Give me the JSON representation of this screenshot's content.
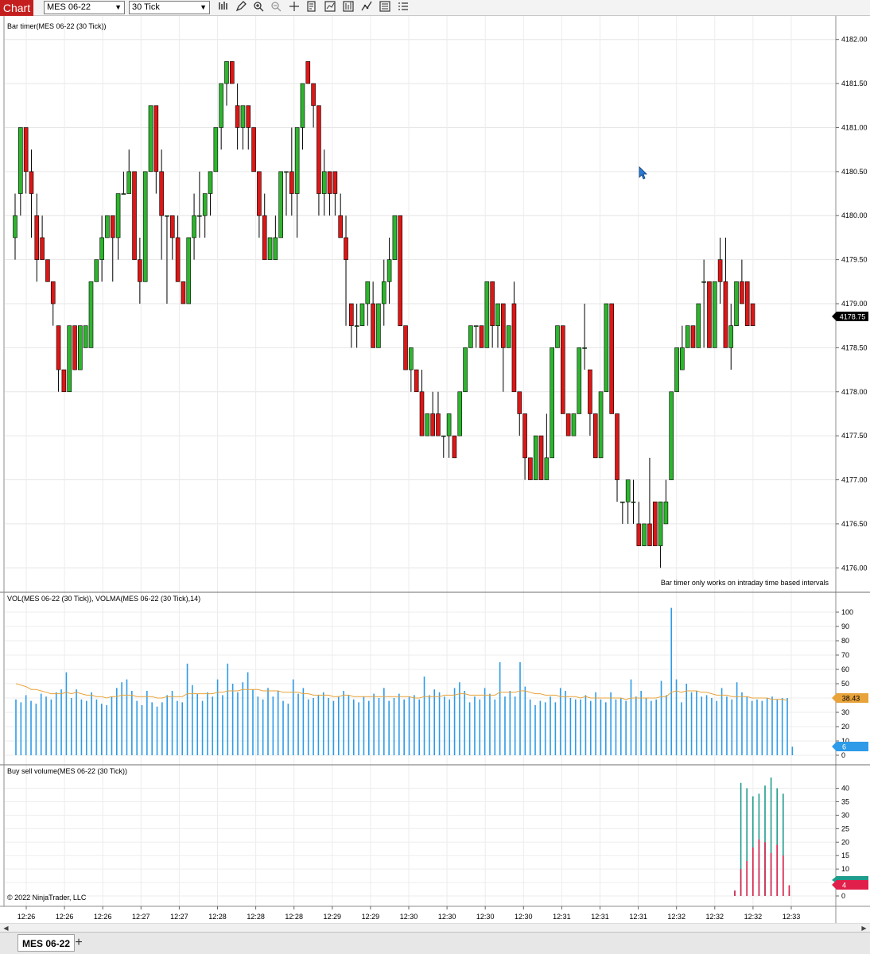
{
  "toolbar": {
    "title": "Chart",
    "instrument": "MES 06-22",
    "interval": "30 Tick",
    "icons": [
      "bar-type-icon",
      "draw-pencil-icon",
      "zoom-in-icon",
      "zoom-out-icon",
      "crosshair-icon",
      "data-box-icon",
      "indicators-icon",
      "strategies-icon",
      "drawing-tools-icon",
      "properties-icon",
      "chart-trader-icon"
    ]
  },
  "price_panel": {
    "label": "Bar timer(MES 06-22 (30 Tick))",
    "message": "Bar timer only works on intraday time based intervals",
    "price_ticks": [
      "4182.00",
      "4181.50",
      "4181.00",
      "4180.50",
      "4180.00",
      "4179.50",
      "4179.00",
      "4178.50",
      "4178.00",
      "4177.50",
      "4177.00",
      "4176.50",
      "4176.00"
    ],
    "last_price": "4178.75",
    "colors": {
      "up": "#2db52d",
      "down": "#dd1616",
      "last_badge": "#000000"
    }
  },
  "volume_panel": {
    "label": "VOL(MES 06-22 (30 Tick)), VOLMA(MES 06-22 (30 Tick),14)",
    "ticks": [
      "100",
      "90",
      "80",
      "70",
      "60",
      "50",
      "40",
      "30",
      "20",
      "10",
      "0"
    ],
    "volma_value": "38.43",
    "last_volume": "6",
    "colors": {
      "volume": "#2d9be8",
      "volma": "#e8a33a"
    }
  },
  "buysell_panel": {
    "label": "Buy sell volume(MES 06-22 (30 Tick))",
    "ticks": [
      "40",
      "35",
      "30",
      "25",
      "20",
      "15",
      "10",
      "5",
      "0"
    ],
    "buy_value": "",
    "sell_value": "4",
    "colors": {
      "buy": "#1f9c8c",
      "sell": "#e0204a"
    }
  },
  "copyright": "© 2022 NinjaTrader, LLC",
  "time_ticks": [
    "12:26",
    "12:26",
    "12:26",
    "12:27",
    "12:27",
    "12:28",
    "12:28",
    "12:28",
    "12:29",
    "12:29",
    "12:30",
    "12:30",
    "12:30",
    "12:30",
    "12:31",
    "12:31",
    "12:31",
    "12:32",
    "12:32",
    "12:32",
    "12:33"
  ],
  "tab": {
    "label": "MES 06-22",
    "add": "+"
  },
  "chart_data": {
    "type": "candlestick",
    "bars": [
      {
        "o": 4179.75,
        "h": 4180.25,
        "l": 4179.5,
        "c": 4180.0
      },
      {
        "o": 4180.25,
        "h": 4181.0,
        "l": 4180.0,
        "c": 4181.0
      },
      {
        "o": 4181.0,
        "h": 4181.0,
        "l": 4180.25,
        "c": 4180.5
      },
      {
        "o": 4180.5,
        "h": 4180.75,
        "l": 4179.75,
        "c": 4180.25
      },
      {
        "o": 4180.0,
        "h": 4180.25,
        "l": 4179.25,
        "c": 4179.5
      },
      {
        "o": 4179.75,
        "h": 4180.0,
        "l": 4179.5,
        "c": 4179.5
      },
      {
        "o": 4179.5,
        "h": 4179.5,
        "l": 4179.25,
        "c": 4179.25
      },
      {
        "o": 4179.25,
        "h": 4179.25,
        "l": 4178.75,
        "c": 4179.0
      },
      {
        "o": 4178.75,
        "h": 4178.75,
        "l": 4178.0,
        "c": 4178.25
      },
      {
        "o": 4178.25,
        "h": 4178.25,
        "l": 4178.0,
        "c": 4178.0
      },
      {
        "o": 4178.0,
        "h": 4178.75,
        "l": 4178.0,
        "c": 4178.75
      },
      {
        "o": 4178.75,
        "h": 4178.75,
        "l": 4178.25,
        "c": 4178.25
      },
      {
        "o": 4178.25,
        "h": 4178.75,
        "l": 4178.25,
        "c": 4178.75
      },
      {
        "o": 4178.5,
        "h": 4178.75,
        "l": 4178.5,
        "c": 4178.75
      },
      {
        "o": 4178.5,
        "h": 4179.25,
        "l": 4178.5,
        "c": 4179.25
      },
      {
        "o": 4179.25,
        "h": 4179.5,
        "l": 4179.25,
        "c": 4179.5
      },
      {
        "o": 4179.5,
        "h": 4180.0,
        "l": 4179.25,
        "c": 4179.75
      },
      {
        "o": 4179.75,
        "h": 4180.0,
        "l": 4179.75,
        "c": 4180.0
      },
      {
        "o": 4180.0,
        "h": 4180.0,
        "l": 4179.25,
        "c": 4179.75
      },
      {
        "o": 4179.75,
        "h": 4180.25,
        "l": 4179.5,
        "c": 4180.25
      },
      {
        "o": 4180.25,
        "h": 4180.5,
        "l": 4180.25,
        "c": 4180.25
      },
      {
        "o": 4180.25,
        "h": 4180.75,
        "l": 4180.25,
        "c": 4180.5
      },
      {
        "o": 4180.5,
        "h": 4180.5,
        "l": 4179.5,
        "c": 4179.5
      },
      {
        "o": 4179.5,
        "h": 4179.75,
        "l": 4179.0,
        "c": 4179.25
      },
      {
        "o": 4179.25,
        "h": 4180.5,
        "l": 4179.25,
        "c": 4180.5
      },
      {
        "o": 4180.5,
        "h": 4181.25,
        "l": 4180.5,
        "c": 4181.25
      },
      {
        "o": 4181.25,
        "h": 4181.25,
        "l": 4180.25,
        "c": 4180.5
      },
      {
        "o": 4180.5,
        "h": 4180.75,
        "l": 4179.5,
        "c": 4180.0
      },
      {
        "o": 4180.0,
        "h": 4180.0,
        "l": 4179.0,
        "c": 4180.0
      },
      {
        "o": 4180.0,
        "h": 4180.0,
        "l": 4179.5,
        "c": 4179.75
      },
      {
        "o": 4179.75,
        "h": 4180.0,
        "l": 4179.25,
        "c": 4179.25
      },
      {
        "o": 4179.25,
        "h": 4179.25,
        "l": 4179.0,
        "c": 4179.0
      },
      {
        "o": 4179.0,
        "h": 4179.75,
        "l": 4179.0,
        "c": 4179.75
      },
      {
        "o": 4179.75,
        "h": 4180.25,
        "l": 4179.5,
        "c": 4180.0
      },
      {
        "o": 4180.0,
        "h": 4180.5,
        "l": 4179.75,
        "c": 4180.0
      },
      {
        "o": 4180.0,
        "h": 4180.25,
        "l": 4179.75,
        "c": 4180.25
      },
      {
        "o": 4180.25,
        "h": 4180.5,
        "l": 4180.0,
        "c": 4180.5
      },
      {
        "o": 4180.5,
        "h": 4181.0,
        "l": 4180.5,
        "c": 4181.0
      },
      {
        "o": 4181.0,
        "h": 4181.5,
        "l": 4180.75,
        "c": 4181.5
      },
      {
        "o": 4181.5,
        "h": 4181.75,
        "l": 4181.25,
        "c": 4181.75
      },
      {
        "o": 4181.75,
        "h": 4181.75,
        "l": 4181.5,
        "c": 4181.5
      },
      {
        "o": 4181.25,
        "h": 4181.5,
        "l": 4180.75,
        "c": 4181.0
      },
      {
        "o": 4181.0,
        "h": 4181.25,
        "l": 4180.75,
        "c": 4181.25
      },
      {
        "o": 4181.25,
        "h": 4181.25,
        "l": 4180.75,
        "c": 4181.0
      },
      {
        "o": 4181.0,
        "h": 4181.0,
        "l": 4180.5,
        "c": 4180.5
      },
      {
        "o": 4180.5,
        "h": 4180.5,
        "l": 4179.75,
        "c": 4180.0
      },
      {
        "o": 4180.0,
        "h": 4180.25,
        "l": 4179.5,
        "c": 4179.5
      },
      {
        "o": 4179.5,
        "h": 4179.75,
        "l": 4179.5,
        "c": 4179.75
      },
      {
        "o": 4179.5,
        "h": 4180.0,
        "l": 4179.5,
        "c": 4179.75
      },
      {
        "o": 4179.75,
        "h": 4180.5,
        "l": 4179.75,
        "c": 4180.5
      },
      {
        "o": 4180.5,
        "h": 4180.5,
        "l": 4180.0,
        "c": 4180.5
      },
      {
        "o": 4180.5,
        "h": 4181.0,
        "l": 4180.0,
        "c": 4180.25
      },
      {
        "o": 4180.25,
        "h": 4181.0,
        "l": 4179.75,
        "c": 4181.0
      },
      {
        "o": 4181.0,
        "h": 4181.5,
        "l": 4180.75,
        "c": 4181.5
      },
      {
        "o": 4181.75,
        "h": 4181.75,
        "l": 4181.5,
        "c": 4181.5
      },
      {
        "o": 4181.5,
        "h": 4181.5,
        "l": 4181.0,
        "c": 4181.25
      },
      {
        "o": 4181.25,
        "h": 4181.25,
        "l": 4180.0,
        "c": 4180.25
      },
      {
        "o": 4180.25,
        "h": 4180.75,
        "l": 4180.0,
        "c": 4180.5
      },
      {
        "o": 4180.5,
        "h": 4180.5,
        "l": 4180.0,
        "c": 4180.25
      },
      {
        "o": 4180.5,
        "h": 4180.5,
        "l": 4180.0,
        "c": 4180.25
      },
      {
        "o": 4180.0,
        "h": 4180.25,
        "l": 4179.75,
        "c": 4179.75
      },
      {
        "o": 4179.75,
        "h": 4180.0,
        "l": 4178.75,
        "c": 4179.5
      },
      {
        "o": 4179.0,
        "h": 4179.0,
        "l": 4178.5,
        "c": 4178.75
      },
      {
        "o": 4178.75,
        "h": 4179.0,
        "l": 4178.5,
        "c": 4178.75
      },
      {
        "o": 4178.75,
        "h": 4179.0,
        "l": 4178.75,
        "c": 4179.0
      },
      {
        "o": 4179.0,
        "h": 4179.25,
        "l": 4178.75,
        "c": 4179.25
      },
      {
        "o": 4179.0,
        "h": 4179.25,
        "l": 4178.5,
        "c": 4178.5
      },
      {
        "o": 4178.5,
        "h": 4179.0,
        "l": 4178.5,
        "c": 4179.0
      },
      {
        "o": 4179.0,
        "h": 4179.5,
        "l": 4178.75,
        "c": 4179.25
      },
      {
        "o": 4179.25,
        "h": 4179.75,
        "l": 4179.0,
        "c": 4179.5
      },
      {
        "o": 4179.5,
        "h": 4180.0,
        "l": 4179.5,
        "c": 4180.0
      },
      {
        "o": 4180.0,
        "h": 4180.0,
        "l": 4178.75,
        "c": 4178.75
      },
      {
        "o": 4178.75,
        "h": 4178.75,
        "l": 4178.25,
        "c": 4178.25
      },
      {
        "o": 4178.25,
        "h": 4178.5,
        "l": 4178.0,
        "c": 4178.5
      },
      {
        "o": 4178.25,
        "h": 4178.25,
        "l": 4178.0,
        "c": 4178.0
      },
      {
        "o": 4178.0,
        "h": 4178.25,
        "l": 4177.5,
        "c": 4177.5
      },
      {
        "o": 4177.5,
        "h": 4177.75,
        "l": 4177.5,
        "c": 4177.75
      },
      {
        "o": 4177.75,
        "h": 4178.0,
        "l": 4177.5,
        "c": 4177.5
      },
      {
        "o": 4177.75,
        "h": 4178.0,
        "l": 4177.5,
        "c": 4177.5
      },
      {
        "o": 4177.5,
        "h": 4177.5,
        "l": 4177.25,
        "c": 4177.5
      },
      {
        "o": 4177.5,
        "h": 4177.75,
        "l": 4177.25,
        "c": 4177.75
      },
      {
        "o": 4177.5,
        "h": 4177.5,
        "l": 4177.25,
        "c": 4177.25
      },
      {
        "o": 4177.5,
        "h": 4178.0,
        "l": 4177.5,
        "c": 4178.0
      },
      {
        "o": 4178.0,
        "h": 4178.5,
        "l": 4178.0,
        "c": 4178.5
      },
      {
        "o": 4178.5,
        "h": 4178.75,
        "l": 4178.5,
        "c": 4178.75
      },
      {
        "o": 4178.75,
        "h": 4178.75,
        "l": 4178.5,
        "c": 4178.75
      },
      {
        "o": 4178.75,
        "h": 4178.75,
        "l": 4178.5,
        "c": 4178.5
      },
      {
        "o": 4178.5,
        "h": 4179.25,
        "l": 4178.5,
        "c": 4179.25
      },
      {
        "o": 4179.25,
        "h": 4179.25,
        "l": 4178.5,
        "c": 4178.75
      },
      {
        "o": 4178.75,
        "h": 4179.0,
        "l": 4178.5,
        "c": 4179.0
      },
      {
        "o": 4179.0,
        "h": 4179.0,
        "l": 4178.0,
        "c": 4178.5
      },
      {
        "o": 4178.5,
        "h": 4178.75,
        "l": 4178.5,
        "c": 4178.75
      },
      {
        "o": 4179.0,
        "h": 4179.25,
        "l": 4178.0,
        "c": 4178.0
      },
      {
        "o": 4178.0,
        "h": 4178.0,
        "l": 4177.5,
        "c": 4177.75
      },
      {
        "o": 4177.75,
        "h": 4177.75,
        "l": 4177.0,
        "c": 4177.25
      },
      {
        "o": 4177.25,
        "h": 4177.25,
        "l": 4177.0,
        "c": 4177.0
      },
      {
        "o": 4177.0,
        "h": 4177.5,
        "l": 4177.0,
        "c": 4177.5
      },
      {
        "o": 4177.5,
        "h": 4177.5,
        "l": 4177.0,
        "c": 4177.0
      },
      {
        "o": 4177.0,
        "h": 4177.75,
        "l": 4177.0,
        "c": 4177.25
      },
      {
        "o": 4177.25,
        "h": 4178.5,
        "l": 4177.25,
        "c": 4178.5
      },
      {
        "o": 4178.5,
        "h": 4178.75,
        "l": 4178.5,
        "c": 4178.75
      },
      {
        "o": 4178.75,
        "h": 4178.75,
        "l": 4177.75,
        "c": 4177.75
      },
      {
        "o": 4177.75,
        "h": 4177.75,
        "l": 4177.5,
        "c": 4177.5
      },
      {
        "o": 4177.5,
        "h": 4177.75,
        "l": 4177.5,
        "c": 4177.75
      },
      {
        "o": 4177.75,
        "h": 4178.5,
        "l": 4177.75,
        "c": 4178.5
      },
      {
        "o": 4178.5,
        "h": 4179.0,
        "l": 4178.25,
        "c": 4178.5
      },
      {
        "o": 4178.25,
        "h": 4178.25,
        "l": 4177.5,
        "c": 4177.75
      },
      {
        "o": 4177.75,
        "h": 4177.75,
        "l": 4177.25,
        "c": 4177.25
      },
      {
        "o": 4177.25,
        "h": 4178.0,
        "l": 4177.25,
        "c": 4178.0
      },
      {
        "o": 4178.0,
        "h": 4179.0,
        "l": 4178.0,
        "c": 4179.0
      },
      {
        "o": 4179.0,
        "h": 4179.0,
        "l": 4177.75,
        "c": 4177.75
      },
      {
        "o": 4177.75,
        "h": 4177.75,
        "l": 4176.75,
        "c": 4177.0
      },
      {
        "o": 4176.75,
        "h": 4176.75,
        "l": 4176.5,
        "c": 4176.75
      },
      {
        "o": 4176.75,
        "h": 4177.0,
        "l": 4176.5,
        "c": 4177.0
      },
      {
        "o": 4176.75,
        "h": 4177.0,
        "l": 4176.5,
        "c": 4176.75
      },
      {
        "o": 4176.5,
        "h": 4176.75,
        "l": 4176.25,
        "c": 4176.25
      },
      {
        "o": 4176.25,
        "h": 4176.5,
        "l": 4176.25,
        "c": 4176.5
      },
      {
        "o": 4176.5,
        "h": 4177.25,
        "l": 4176.25,
        "c": 4176.25
      },
      {
        "o": 4176.75,
        "h": 4176.75,
        "l": 4176.25,
        "c": 4176.25
      },
      {
        "o": 4176.25,
        "h": 4176.75,
        "l": 4176.0,
        "c": 4176.75
      },
      {
        "o": 4176.5,
        "h": 4177.0,
        "l": 4176.5,
        "c": 4176.75
      },
      {
        "o": 4177.0,
        "h": 4178.0,
        "l": 4177.0,
        "c": 4178.0
      },
      {
        "o": 4178.0,
        "h": 4178.5,
        "l": 4178.0,
        "c": 4178.5
      },
      {
        "o": 4178.25,
        "h": 4178.75,
        "l": 4178.25,
        "c": 4178.5
      },
      {
        "o": 4178.5,
        "h": 4178.75,
        "l": 4178.5,
        "c": 4178.75
      },
      {
        "o": 4178.75,
        "h": 4178.75,
        "l": 4178.5,
        "c": 4178.5
      },
      {
        "o": 4178.5,
        "h": 4179.0,
        "l": 4178.5,
        "c": 4179.0
      },
      {
        "o": 4179.25,
        "h": 4179.5,
        "l": 4178.5,
        "c": 4179.25
      },
      {
        "o": 4179.25,
        "h": 4179.25,
        "l": 4178.5,
        "c": 4178.5
      },
      {
        "o": 4178.5,
        "h": 4179.25,
        "l": 4178.5,
        "c": 4179.25
      },
      {
        "o": 4179.5,
        "h": 4179.75,
        "l": 4179.0,
        "c": 4179.25
      },
      {
        "o": 4179.25,
        "h": 4179.75,
        "l": 4178.5,
        "c": 4178.5
      },
      {
        "o": 4178.5,
        "h": 4179.0,
        "l": 4178.25,
        "c": 4178.75
      },
      {
        "o": 4178.75,
        "h": 4179.25,
        "l": 4178.75,
        "c": 4179.25
      },
      {
        "o": 4179.25,
        "h": 4179.5,
        "l": 4179.0,
        "c": 4179.0
      },
      {
        "o": 4179.25,
        "h": 4179.25,
        "l": 4178.75,
        "c": 4178.75
      },
      {
        "o": 4179.0,
        "h": 4179.0,
        "l": 4178.75,
        "c": 4178.75
      }
    ],
    "volume": [
      39,
      37,
      42,
      38,
      36,
      43,
      41,
      39,
      44,
      46,
      58,
      40,
      46,
      39,
      38,
      44,
      39,
      36,
      35,
      41,
      47,
      51,
      53,
      45,
      38,
      35,
      45,
      37,
      34,
      37,
      42,
      45,
      38,
      37,
      64,
      49,
      43,
      38,
      44,
      41,
      53,
      42,
      64,
      50,
      44,
      51,
      58,
      46,
      41,
      39,
      47,
      41,
      45,
      38,
      36,
      53,
      43,
      47,
      39,
      40,
      42,
      44,
      40,
      38,
      41,
      45,
      42,
      39,
      37,
      41,
      38,
      43,
      40,
      47,
      38,
      40,
      43,
      39,
      41,
      42,
      39,
      55,
      42,
      46,
      44,
      41,
      39,
      47,
      51,
      45,
      37,
      41,
      39,
      47,
      43,
      39,
      65,
      41,
      45,
      41,
      65,
      48,
      39,
      35,
      38,
      37,
      41,
      37,
      47,
      45,
      40,
      39,
      39,
      42,
      38,
      44,
      39,
      37,
      44,
      39,
      40,
      38,
      53,
      41,
      45,
      40,
      38,
      39,
      52,
      42,
      103,
      53,
      37,
      50,
      44,
      45,
      41,
      42,
      40,
      38,
      47,
      41,
      39,
      51,
      44,
      41,
      38,
      39,
      38,
      40,
      41,
      39,
      40,
      40,
      6
    ],
    "volma": [
      50,
      49,
      48,
      46,
      46,
      45,
      44,
      43,
      43,
      43,
      44,
      43,
      44,
      43,
      42,
      42,
      41,
      41,
      40,
      41,
      41,
      42,
      42,
      42,
      41,
      41,
      41,
      41,
      40,
      40,
      41,
      41,
      41,
      41,
      43,
      43,
      43,
      43,
      43,
      43,
      44,
      44,
      45,
      45,
      45,
      46,
      46,
      46,
      46,
      45,
      45,
      45,
      45,
      44,
      44,
      44,
      44,
      43,
      43,
      42,
      42,
      42,
      42,
      41,
      41,
      42,
      42,
      41,
      41,
      41,
      41,
      41,
      41,
      41,
      41,
      41,
      41,
      41,
      41,
      40,
      40,
      41,
      41,
      41,
      41,
      42,
      42,
      42,
      43,
      43,
      42,
      42,
      42,
      42,
      42,
      42,
      44,
      44,
      44,
      44,
      45,
      45,
      44,
      43,
      43,
      42,
      42,
      42,
      41,
      41,
      41,
      41,
      40,
      41,
      40,
      40,
      40,
      40,
      40,
      40,
      40,
      39,
      40,
      40,
      40,
      40,
      40,
      40,
      41,
      41,
      44,
      45,
      44,
      45,
      45,
      45,
      44,
      44,
      43,
      42,
      42,
      42,
      41,
      41,
      41,
      41,
      40,
      40,
      40,
      40,
      39,
      39,
      39,
      38.43
    ],
    "buy": [
      2,
      42,
      40,
      37,
      38,
      41,
      44,
      40,
      38,
      2
    ],
    "sell": [
      2,
      10,
      13,
      18,
      21,
      20,
      16,
      19,
      15,
      4
    ],
    "price_range": [
      4175.75,
      4182.25
    ],
    "volume_range": [
      0,
      105
    ],
    "buysell_range": [
      0,
      44
    ]
  }
}
